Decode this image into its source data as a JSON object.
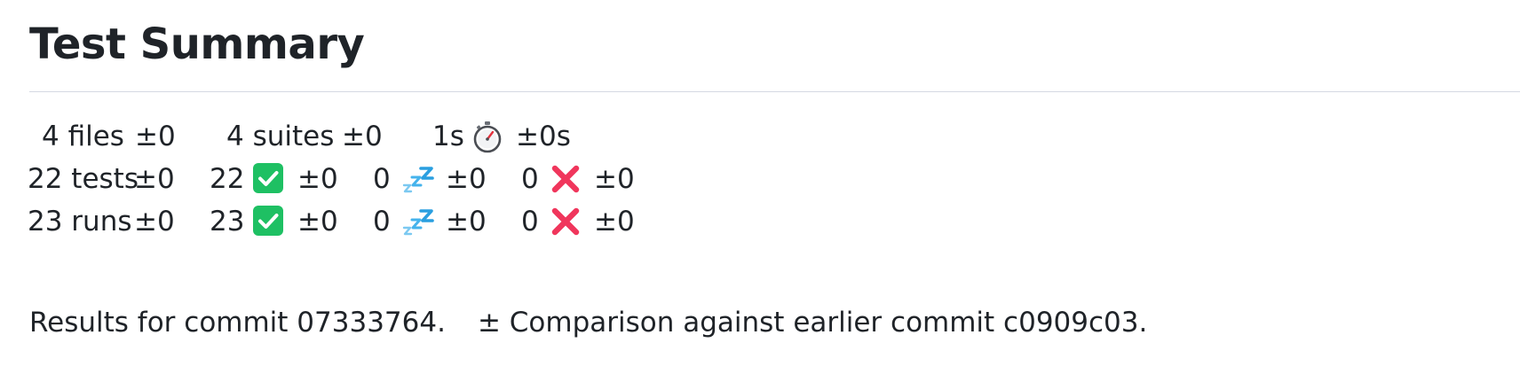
{
  "title": "Test Summary",
  "summary": {
    "row1": {
      "files": "4 files",
      "files_delta": "±0",
      "suites": "4 suites",
      "suites_delta": "±0",
      "duration": "1s",
      "duration_icon": "stopwatch-icon",
      "duration_delta": "±0s"
    },
    "row2": {
      "tests": "22 tests",
      "tests_delta": "±0",
      "passed": "22",
      "passed_delta": "±0",
      "skipped": "0",
      "skipped_delta": "±0",
      "failed": "0",
      "failed_delta": "±0"
    },
    "row3": {
      "runs": "23 runs",
      "runs_delta": "±0",
      "passed": "23",
      "passed_delta": "±0",
      "skipped": "0",
      "skipped_delta": "±0",
      "failed": "0",
      "failed_delta": "±0"
    },
    "icons": {
      "passed": "check-mark-icon",
      "skipped": "sleeping-zzz-icon",
      "failed": "cross-mark-icon"
    },
    "colors": {
      "passed": "#1ec063",
      "skipped": "#2a9fe0",
      "failed": "#f0365c"
    }
  },
  "footer": {
    "results": "Results for commit 07333764.",
    "comparison": "± Comparison against earlier commit c0909c03."
  }
}
